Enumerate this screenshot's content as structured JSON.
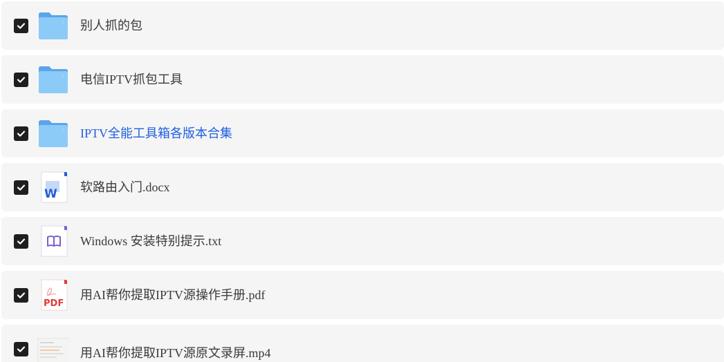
{
  "files": [
    {
      "name": "别人抓的包",
      "type": "folder",
      "checked": true,
      "icon": "folder-icon"
    },
    {
      "name": "电信IPTV抓包工具",
      "type": "folder",
      "checked": true,
      "icon": "folder-icon"
    },
    {
      "name": "IPTV全能工具箱各版本合集",
      "type": "folder",
      "checked": true,
      "icon": "folder-icon",
      "highlight_color": "#1f5fe0"
    },
    {
      "name": "软路由入门.docx",
      "type": "docx",
      "checked": true,
      "icon": "word-doc-icon"
    },
    {
      "name": "Windows 安装特别提示.txt",
      "type": "txt",
      "checked": true,
      "icon": "text-file-icon"
    },
    {
      "name": "用AI帮你提取IPTV源操作手册.pdf",
      "type": "pdf",
      "checked": true,
      "icon": "pdf-file-icon"
    },
    {
      "name": "用AI帮你提取IPTV源原文录屏.mp4",
      "type": "mp4",
      "checked": true,
      "icon": "video-thumbnail-icon"
    }
  ],
  "icon_labels": {
    "word": "W",
    "pdf": "PDF"
  },
  "colors": {
    "row_bg": "#f5f5f5",
    "checkbox": "#1f1f1f",
    "folder": "#7fbdf5",
    "link": "#1f5fe0",
    "pdf": "#e03a3a",
    "word": "#1f5fd6",
    "txt": "#7b5fd6"
  }
}
